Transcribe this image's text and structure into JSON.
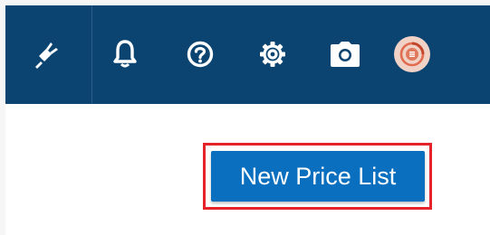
{
  "header": {
    "background": "#0b4470",
    "icons": [
      "plug-icon",
      "bell-icon",
      "help-icon",
      "gear-icon",
      "camera-icon",
      "avatar"
    ]
  },
  "main": {
    "new_price_list_label": "New Price List",
    "button_color": "#0a6fbe",
    "highlight_color": "#e5232a"
  }
}
